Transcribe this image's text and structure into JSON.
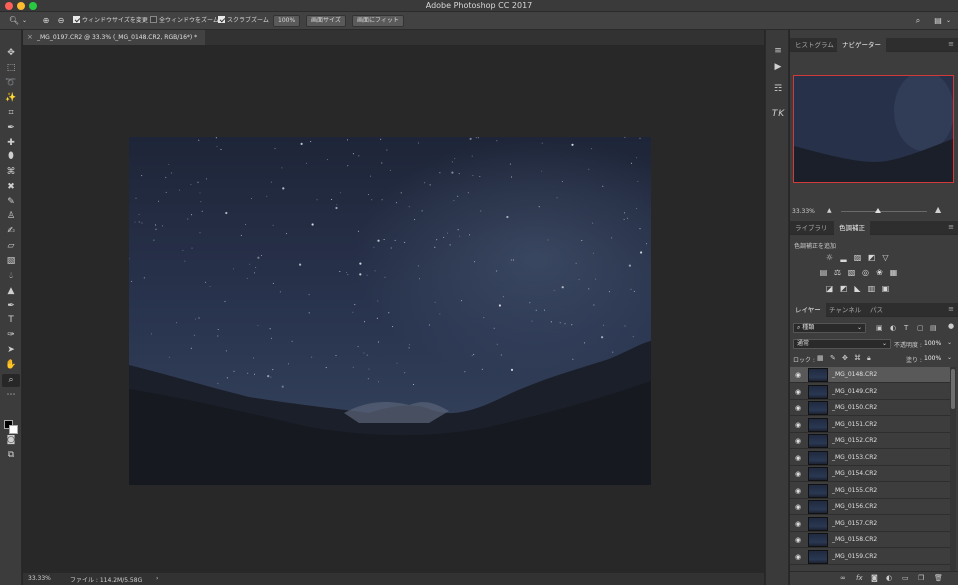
{
  "window": {
    "title": "Adobe Photoshop CC 2017"
  },
  "options_bar": {
    "resize_windows_label": "ウィンドウサイズを変更",
    "zoom_all_label": "全ウィンドウをズーム",
    "scrubby_zoom_label": "スクラブズーム",
    "zoom_value": "100%",
    "fit_screen_label": "画面サイズ",
    "fill_screen_label": "画面にフィット"
  },
  "document": {
    "tab_title": "_MG_0197.CR2 @ 33.3% (_MG_0148.CR2, RGB/16*) *",
    "zoom": "33.33%",
    "file_info": "ファイル : 114.2M/5.58G"
  },
  "navigator_panel": {
    "tabs": [
      "ヒストグラム",
      "ナビゲーター"
    ],
    "active_tab": "ナビゲーター",
    "zoom": "33.33%"
  },
  "adjustments_panel": {
    "tabs": [
      "ライブラリ",
      "色調補正"
    ],
    "active_tab": "色調補正",
    "add_label": "色調補正を追加"
  },
  "layers_panel": {
    "tabs": [
      "レイヤー",
      "チャンネル",
      "パス"
    ],
    "active_tab": "レイヤー",
    "filter_kind": "種類",
    "blend_mode": "通常",
    "opacity_label": "不透明度 :",
    "opacity_value": "100%",
    "lock_label": "ロック :",
    "fill_label": "塗り :",
    "fill_value": "100%",
    "layers": [
      "_MG_0148.CR2",
      "_MG_0149.CR2",
      "_MG_0150.CR2",
      "_MG_0151.CR2",
      "_MG_0152.CR2",
      "_MG_0153.CR2",
      "_MG_0154.CR2",
      "_MG_0155.CR2",
      "_MG_0156.CR2",
      "_MG_0157.CR2",
      "_MG_0158.CR2",
      "_MG_0159.CR2"
    ],
    "selected_index": 0
  }
}
